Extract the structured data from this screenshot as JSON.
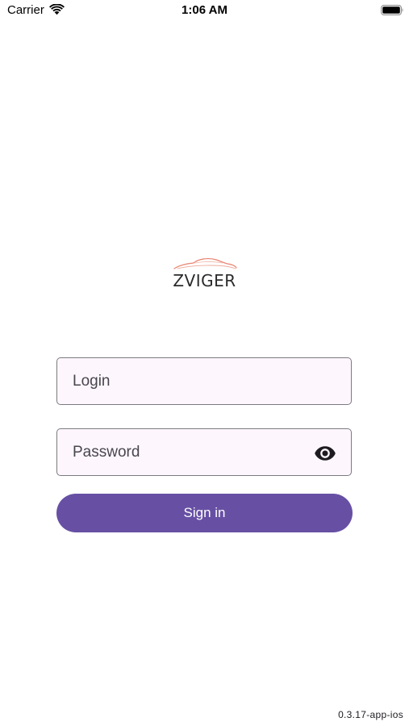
{
  "status_bar": {
    "carrier": "Carrier",
    "time": "1:06 AM",
    "wifi_icon": "wifi-icon",
    "battery_icon": "battery-icon"
  },
  "logo": {
    "text": "ZVIGER",
    "accent_color": "#e8836f"
  },
  "login": {
    "placeholder": "Login",
    "value": ""
  },
  "password": {
    "placeholder": "Password",
    "value": "",
    "toggle_icon": "eye-icon"
  },
  "sign_in": {
    "label": "Sign in",
    "color": "#6750a4"
  },
  "version": "0.3.17-app-ios"
}
